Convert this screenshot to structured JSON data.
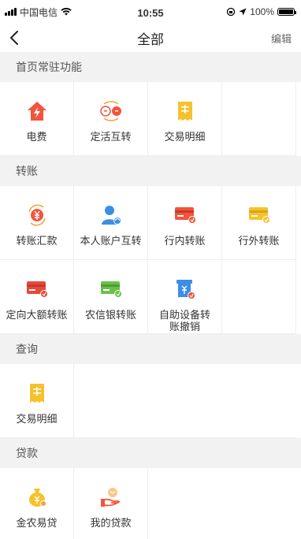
{
  "status": {
    "carrier": "中国电信",
    "time": "10:55",
    "battery": "100%"
  },
  "nav": {
    "title": "全部",
    "edit": "编辑"
  },
  "sections": [
    {
      "title": "首页常驻功能",
      "items": [
        {
          "label": "电费",
          "icon": "electricity-icon"
        },
        {
          "label": "定活互转",
          "icon": "fixed-current-transfer-icon"
        },
        {
          "label": "交易明细",
          "icon": "transaction-detail-icon"
        }
      ]
    },
    {
      "title": "转账",
      "items": [
        {
          "label": "转账汇款",
          "icon": "transfer-remit-icon"
        },
        {
          "label": "本人账户互转",
          "icon": "own-account-transfer-icon"
        },
        {
          "label": "行内转账",
          "icon": "intra-bank-transfer-icon"
        },
        {
          "label": "行外转账",
          "icon": "inter-bank-transfer-icon"
        },
        {
          "label": "定向大额转账",
          "icon": "directed-large-transfer-icon"
        },
        {
          "label": "农信银转账",
          "icon": "rural-credit-transfer-icon"
        },
        {
          "label": "自助设备转账撤销",
          "icon": "atm-transfer-cancel-icon"
        }
      ]
    },
    {
      "title": "查询",
      "items": [
        {
          "label": "交易明细",
          "icon": "transaction-detail-icon"
        }
      ]
    },
    {
      "title": "贷款",
      "items": [
        {
          "label": "金农易贷",
          "icon": "money-bag-icon"
        },
        {
          "label": "我的贷款",
          "icon": "my-loan-icon"
        }
      ]
    }
  ],
  "colors": {
    "red": "#f2543c",
    "orange": "#f7a23a",
    "yellow": "#f6c22b",
    "blue": "#3a8ee6",
    "green": "#6cc04a"
  }
}
